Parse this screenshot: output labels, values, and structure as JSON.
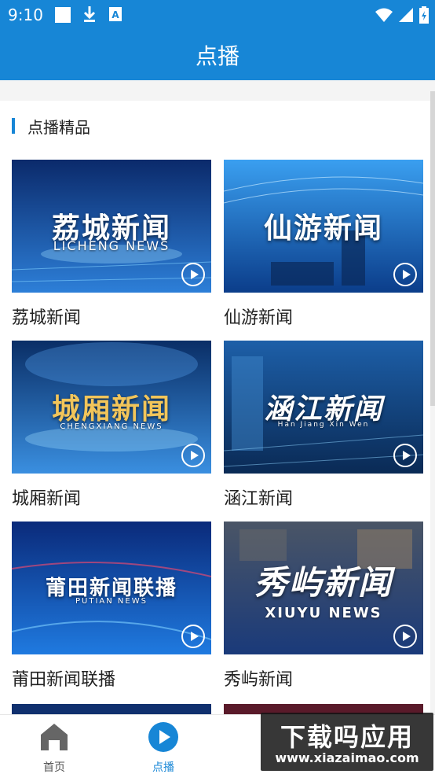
{
  "status_bar": {
    "time": "9:10"
  },
  "app_bar": {
    "title": "点播"
  },
  "section": {
    "title": "点播精品"
  },
  "cards": [
    {
      "label": "荔城新闻",
      "thumb_title": "荔城新闻",
      "thumb_sub": "LICHENG NEWS",
      "color_top": "#0b2a6b",
      "color_bottom": "#2d7fd8"
    },
    {
      "label": "仙游新闻",
      "thumb_title": "仙游新闻",
      "thumb_sub": "",
      "color_top": "#3a9ff0",
      "color_bottom": "#0b3d8a"
    },
    {
      "label": "城厢新闻",
      "thumb_title": "城厢新闻",
      "thumb_sub": "CHENGXIANG NEWS",
      "color_top": "#0a2e66",
      "color_bottom": "#3a8fe0"
    },
    {
      "label": "涵江新闻",
      "thumb_title": "涵江新闻",
      "thumb_sub": "Han Jiang Xin Wen",
      "color_top": "#1d5fa8",
      "color_bottom": "#0a2a55"
    },
    {
      "label": "莆田新闻联播",
      "thumb_title": "莆田新闻联播",
      "thumb_sub": "PUTIAN NEWS",
      "color_top": "#0a2a7a",
      "color_bottom": "#1f7ae0"
    },
    {
      "label": "秀屿新闻",
      "thumb_title": "秀屿新闻",
      "thumb_sub": "XIUYU  NEWS",
      "color_top": "#4a5566",
      "color_bottom": "#1a3a7a"
    }
  ],
  "bottom_nav": {
    "items": [
      {
        "label": "首页",
        "icon": "home-icon"
      },
      {
        "label": "点播",
        "icon": "play-circle-icon"
      }
    ]
  },
  "watermark": {
    "title": "下载吗应用",
    "url": "www.xiazaimao.com"
  },
  "colors": {
    "primary": "#1786d6"
  }
}
